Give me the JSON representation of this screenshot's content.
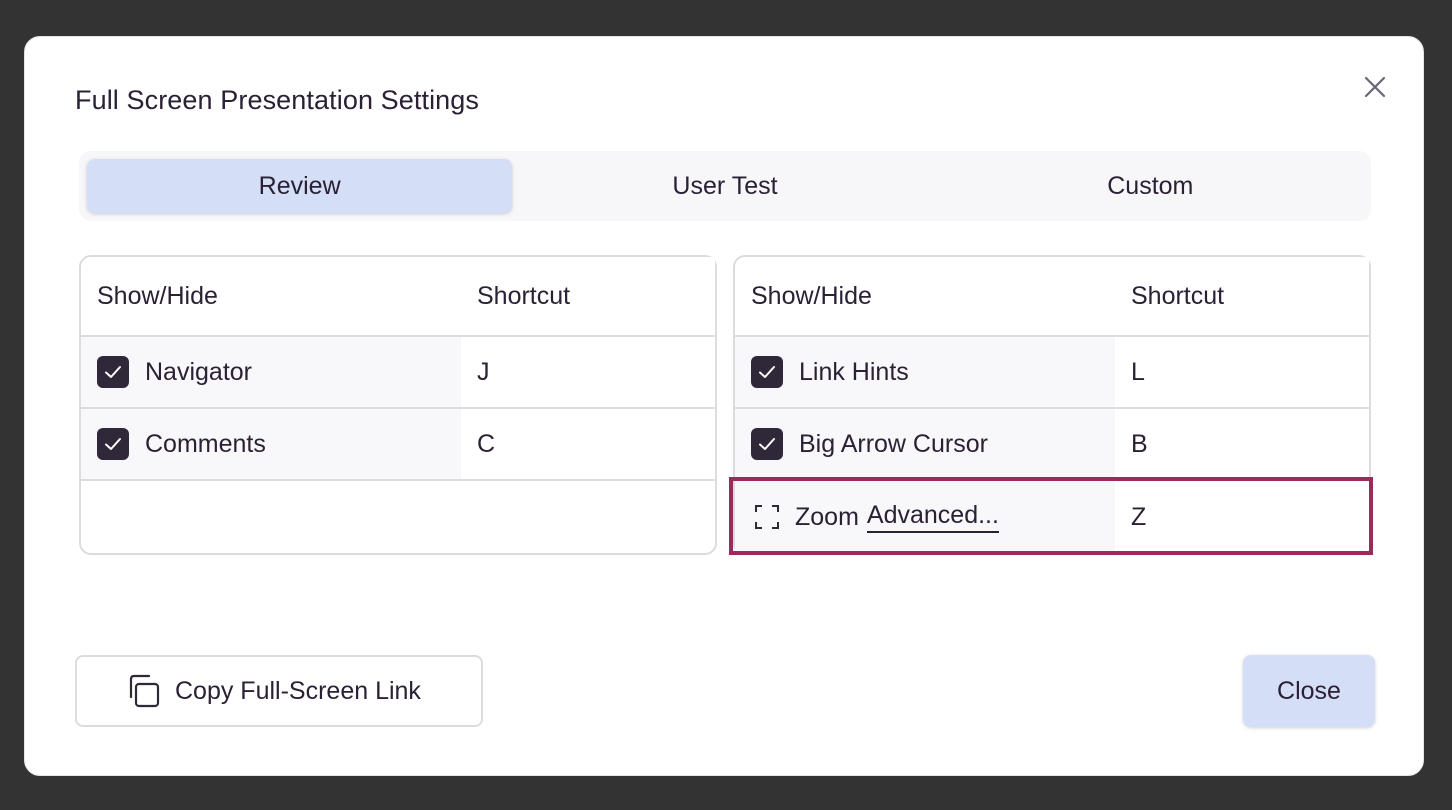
{
  "dialog": {
    "title": "Full Screen Presentation Settings"
  },
  "tabs": [
    {
      "label": "Review",
      "active": true
    },
    {
      "label": "User Test",
      "active": false
    },
    {
      "label": "Custom",
      "active": false
    }
  ],
  "left_table": {
    "headers": {
      "show_hide": "Show/Hide",
      "shortcut": "Shortcut"
    },
    "rows": [
      {
        "label": "Navigator",
        "shortcut": "J",
        "checked": true
      },
      {
        "label": "Comments",
        "shortcut": "C",
        "checked": true
      }
    ]
  },
  "right_table": {
    "headers": {
      "show_hide": "Show/Hide",
      "shortcut": "Shortcut"
    },
    "rows": [
      {
        "label": "Link Hints",
        "shortcut": "L",
        "checked": true
      },
      {
        "label": "Big Arrow Cursor",
        "shortcut": "B",
        "checked": true
      },
      {
        "label": "Zoom",
        "link": "Advanced...",
        "shortcut": "Z",
        "checked": false
      }
    ]
  },
  "footer": {
    "copy_label": "Copy Full-Screen Link",
    "close_label": "Close"
  },
  "colors": {
    "accent": "#d4def6",
    "checkbox": "#2f2838",
    "highlight": "#9c2a5a",
    "backdrop": "#333333"
  }
}
